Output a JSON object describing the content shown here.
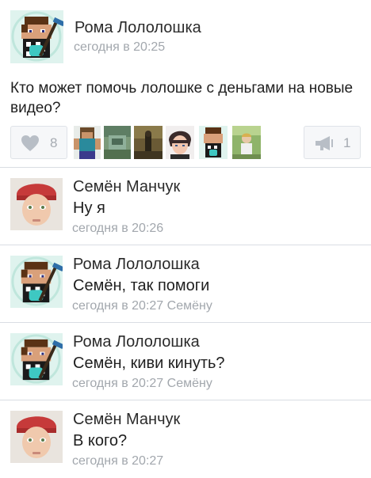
{
  "post": {
    "author": "Рома Лололошка",
    "time": "сегодня в 20:25",
    "text": "Кто может помочь лолошке с деньгами на новые видео?",
    "likes_count": "8",
    "shares_count": "1",
    "icons": {
      "like": "heart-icon",
      "share": "megaphone-icon"
    }
  },
  "likers": [
    {
      "name": "liker-minecraft-steve"
    },
    {
      "name": "liker-minecraft-scene"
    },
    {
      "name": "liker-game-scene"
    },
    {
      "name": "liker-anime-boy"
    },
    {
      "name": "liker-minecraft-skin"
    },
    {
      "name": "liker-child-photo"
    }
  ],
  "comments": [
    {
      "author": "Семён Манчук",
      "text": "Ну я",
      "time": "сегодня в 20:26",
      "reply_to": ""
    },
    {
      "author": "Рома Лололошка",
      "text": "Семён, так помоги",
      "time": "сегодня в 20:27",
      "reply_to": "Семёну"
    },
    {
      "author": "Рома Лололошка",
      "text": "Семён, киви кинуть?",
      "time": "сегодня в 20:27",
      "reply_to": "Семёну"
    },
    {
      "author": "Семён Манчук",
      "text": "В кого?",
      "time": "сегодня в 20:27",
      "reply_to": ""
    }
  ],
  "colors": {
    "author": "#2b2b2b",
    "meta": "#a2a7ad",
    "divider": "#d9dde3",
    "button_bg": "#f6f7f9"
  }
}
